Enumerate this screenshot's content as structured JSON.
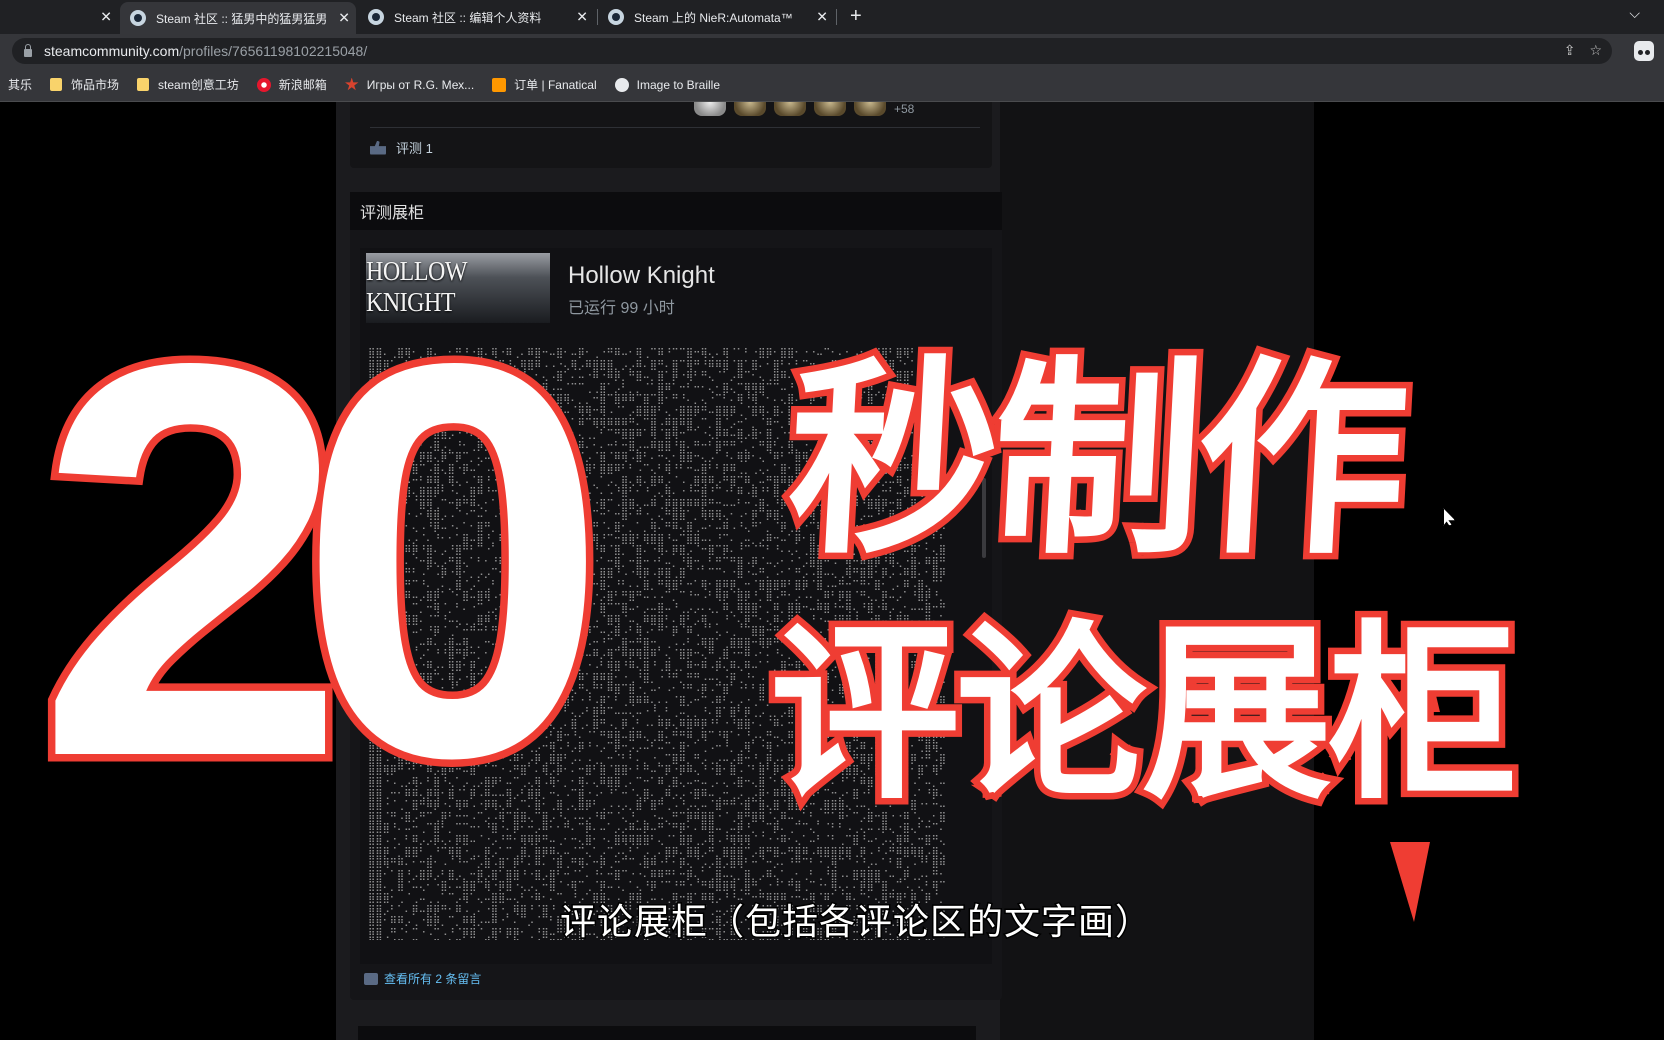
{
  "browser": {
    "tabs": [
      {
        "title": ""
      },
      {
        "title": "Steam 社区 :: 猛男中的猛男猛男"
      },
      {
        "title": "Steam 社区 :: 编辑个人资料"
      },
      {
        "title": "Steam 上的 NieR:Automata™"
      }
    ],
    "url_host": "steamcommunity.com",
    "url_path": "/profiles/76561198102215048/",
    "bookmarks": [
      {
        "label": "其乐",
        "icon": "none"
      },
      {
        "label": "饰品市场",
        "icon": "folder-icon"
      },
      {
        "label": "steam创意工坊",
        "icon": "folder-icon"
      },
      {
        "label": "新浪邮箱",
        "icon": "sina-icon"
      },
      {
        "label": "Игры от R.G. Мех...",
        "icon": "star-icon"
      },
      {
        "label": "订单 | Fanatical",
        "icon": "fanatical-icon"
      },
      {
        "label": "Image to Braille",
        "icon": "braille-icon"
      }
    ]
  },
  "profile": {
    "badges_more": "+58",
    "review_count_label": "评测 1",
    "showcase": {
      "header": "评测展柜",
      "game_capsule_text": "HOLLOW KNIGHT",
      "game_name": "Hollow Knight",
      "playtime": "已运行 99 小时",
      "view_all": "查看所有 2 条留言"
    }
  },
  "overlay": {
    "number": "20",
    "line1": "秒制作",
    "line2": "评论展柜",
    "subtitle": "评论展柜（包括各评论区的文字画）"
  },
  "colors": {
    "accent_red": "#ef3d33",
    "steam_link": "#66c0f4"
  }
}
